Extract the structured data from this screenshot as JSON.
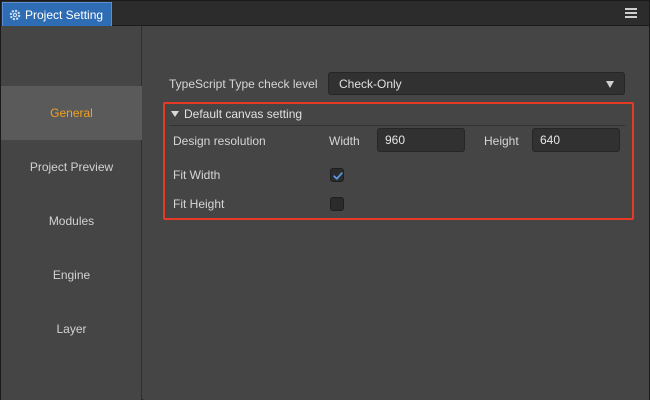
{
  "window": {
    "tab_title": "Project Setting",
    "tab_icon": "gear-icon",
    "menu_icon": "hamburger-menu-icon",
    "accent_color": "#2e6cb4"
  },
  "sidebar": {
    "active_color": "#f0a020",
    "items": [
      {
        "label": "General",
        "active": true
      },
      {
        "label": "Project Preview",
        "active": false
      },
      {
        "label": "Modules",
        "active": false
      },
      {
        "label": "Engine",
        "active": false
      },
      {
        "label": "Layer",
        "active": false
      }
    ]
  },
  "general": {
    "typescript_check": {
      "label": "TypeScript Type check level",
      "selected": "Check-Only"
    },
    "canvas_section": {
      "title": "Default canvas setting",
      "highlight_color": "#e53a26",
      "design_resolution": {
        "label": "Design resolution",
        "width_label": "Width",
        "width_value": "960",
        "height_label": "Height",
        "height_value": "640"
      },
      "fit_width": {
        "label": "Fit Width",
        "checked": true
      },
      "fit_height": {
        "label": "Fit Height",
        "checked": false
      }
    }
  }
}
